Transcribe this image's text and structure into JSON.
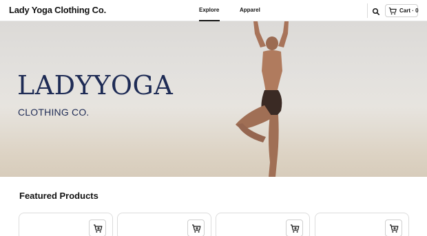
{
  "header": {
    "brand": "Lady Yoga Clothing Co.",
    "nav": [
      {
        "label": "Explore",
        "active": true
      },
      {
        "label": "Apparel",
        "active": false
      }
    ],
    "search_icon": "search-icon",
    "cart_label": "Cart · 0",
    "cart_icon": "cart-icon"
  },
  "hero": {
    "title": "LADYYOGA",
    "subtitle": "CLOTHING CO."
  },
  "featured": {
    "title": "Featured Products",
    "product_count": 4,
    "add_icon": "add-to-cart-icon"
  },
  "colors": {
    "brand_navy": "#1e2b55",
    "text": "#111111",
    "border": "#dcdcdc"
  }
}
